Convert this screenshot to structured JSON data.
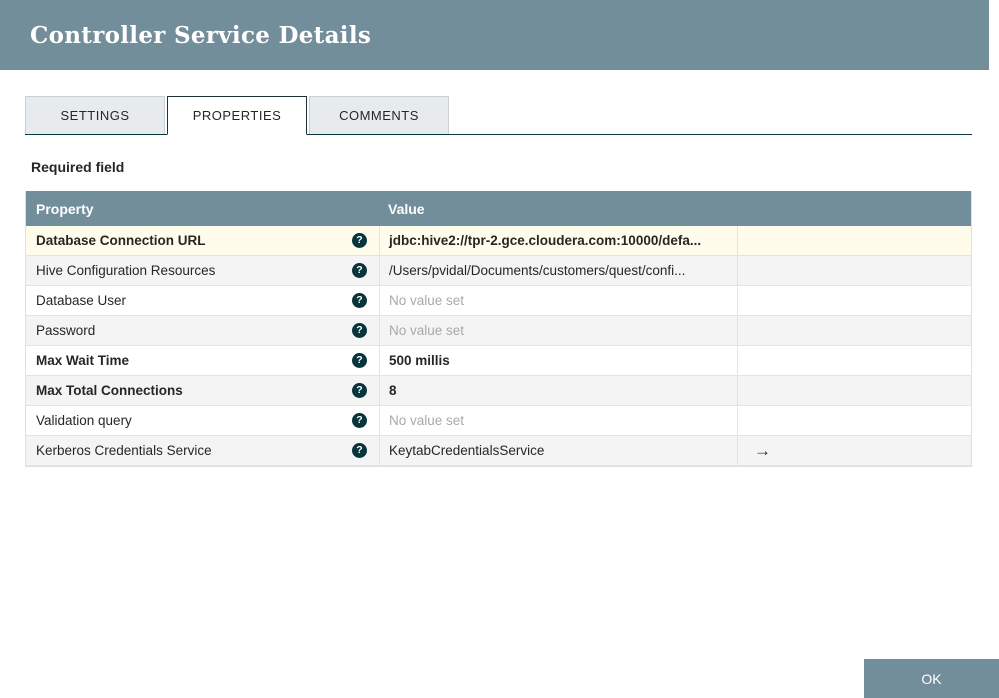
{
  "dialog": {
    "title": "Controller Service Details"
  },
  "tabs": [
    {
      "label": "SETTINGS"
    },
    {
      "label": "PROPERTIES"
    },
    {
      "label": "COMMENTS"
    }
  ],
  "required_field_label": "Required field",
  "table": {
    "headers": {
      "property": "Property",
      "value": "Value"
    },
    "rows": [
      {
        "property": "Database Connection URL",
        "value": "jdbc:hive2://tpr-2.gce.cloudera.com:10000/defa..."
      },
      {
        "property": "Hive Configuration Resources",
        "value": "/Users/pvidal/Documents/customers/quest/confi..."
      },
      {
        "property": "Database User",
        "value": "No value set"
      },
      {
        "property": "Password",
        "value": "No value set"
      },
      {
        "property": "Max Wait Time",
        "value": "500 millis"
      },
      {
        "property": "Max Total Connections",
        "value": "8"
      },
      {
        "property": "Validation query",
        "value": "No value set"
      },
      {
        "property": "Kerberos Credentials Service",
        "value": "KeytabCredentialsService"
      }
    ]
  },
  "icons": {
    "help_glyph": "?",
    "goto_glyph": "→"
  },
  "footer": {
    "ok_label": "OK"
  },
  "colors": {
    "header_bg": "#728e9b",
    "accent": "#07353b",
    "highlight_row_bg": "#fffcec",
    "alt_row_bg": "#f4f4f4"
  }
}
